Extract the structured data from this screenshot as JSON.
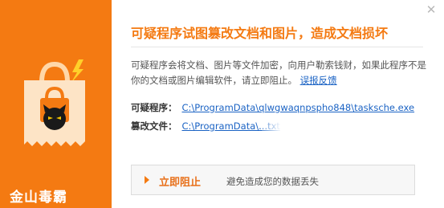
{
  "sidebar": {
    "brand": "金山毒霸",
    "illustration_icon": "locked-document-bag-icon",
    "colors": {
      "accent": "#f47a12",
      "dark": "#1a1a1a",
      "bolt": "#ffd02a"
    }
  },
  "dialog": {
    "close_icon": "close-icon",
    "title": "可疑程序试图篡改文档和图片，造成文档损坏",
    "description": "可疑程序会将文档、图片等文件加密，向用户勒索钱财，如果此程序不是你的文档或图片编辑软件，请立即阻止。",
    "feedback_link": "误报反馈",
    "program_label": "可疑程序：",
    "program_path": "C:\\ProgramData\\qlwgwaqnpspho848\\tasksche.exe",
    "file_label": "篡改文件：",
    "file_path": "C:\\ProgramData\\...txt",
    "stop_button": "立即阻止",
    "stop_hint": "避免造成您的数据丢失"
  }
}
